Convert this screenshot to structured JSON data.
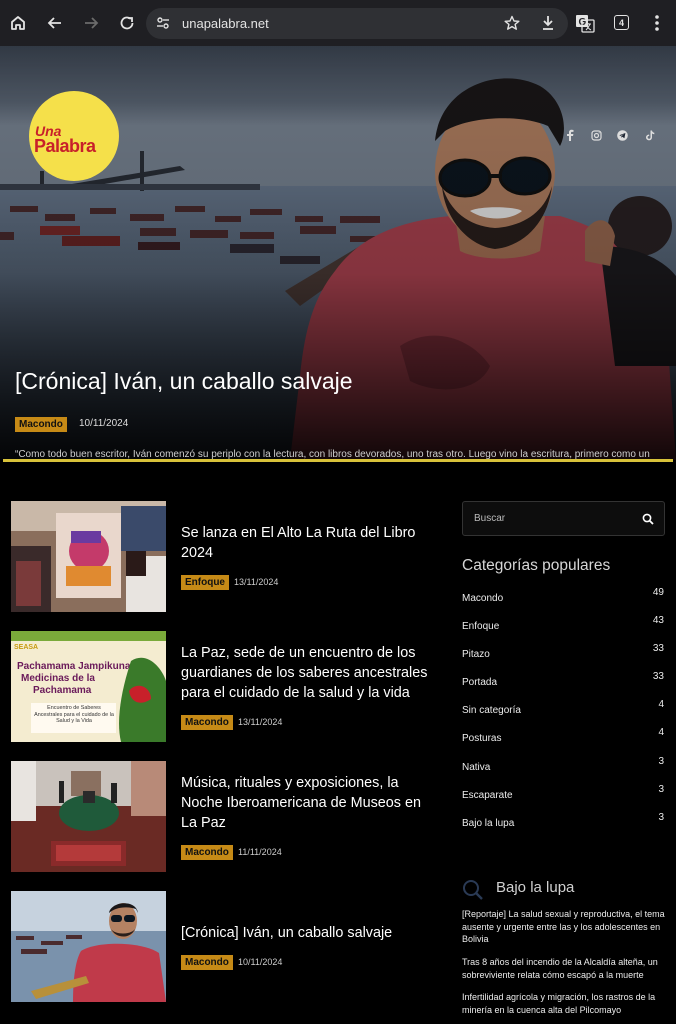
{
  "browser": {
    "url": "unapalabra.net",
    "tab_count": "4",
    "icons": [
      "home-icon",
      "back-icon",
      "forward-icon",
      "reload-icon",
      "site-info-icon",
      "star-icon",
      "download-icon",
      "translate-icon",
      "tabs-icon",
      "menu-icon"
    ]
  },
  "site": {
    "logo_una": "Una",
    "logo_palabra": "Palabra",
    "social_icons": [
      "facebook-icon",
      "instagram-icon",
      "telegram-icon",
      "tiktok-icon"
    ]
  },
  "hero": {
    "title": "[Crónica] Iván, un caballo salvaje",
    "category": "Macondo",
    "date": "10/11/2024",
    "excerpt": "“Como todo buen escritor, Iván comenzó su periplo con la lectura, con libros devorados, uno tras otro. Luego vino la escritura, primero como un juego, luego como una vocación”, escribe el cronista Rodrigo Villegas."
  },
  "articles": [
    {
      "title": "Se lanza en El Alto La Ruta del Libro 2024",
      "category": "Enfoque",
      "date": "13/11/2024"
    },
    {
      "title": "La Paz, sede de un encuentro de los guardianes de los saberes ancestrales para el cuidado de la salud y la vida",
      "category": "Macondo",
      "date": "13/11/2024"
    },
    {
      "title": "Música, rituales y exposiciones, la Noche Iberoamericana de Museos en La Paz",
      "category": "Macondo",
      "date": "11/11/2024"
    },
    {
      "title": "[Crónica] Iván, un caballo salvaje",
      "category": "Macondo",
      "date": "10/11/2024"
    }
  ],
  "thumb_texts": {
    "seasa": "SEASA",
    "pachamama_line1": "Pachamama Jampikuna",
    "pachamama_line2": "Medicinas de la",
    "pachamama_line3": "Pachamama",
    "encuentro": "Encuentro de Saberes Ancestrales para el cuidado de la Salud y la Vida"
  },
  "sidebar": {
    "search_placeholder": "Buscar",
    "categories_heading": "Categorías populares",
    "categories": [
      {
        "name": "Macondo",
        "count": "49"
      },
      {
        "name": "Enfoque",
        "count": "43"
      },
      {
        "name": "Pitazo",
        "count": "33"
      },
      {
        "name": "Portada",
        "count": "33"
      },
      {
        "name": "Sin categoría",
        "count": "4"
      },
      {
        "name": "Posturas",
        "count": "4"
      },
      {
        "name": "Nativa",
        "count": "3"
      },
      {
        "name": "Escaparate",
        "count": "3"
      },
      {
        "name": "Bajo la lupa",
        "count": "3"
      }
    ],
    "lupa_heading": "Bajo la lupa",
    "lupa_items": [
      "[Reportaje] La salud sexual y reproductiva, el tema ausente y urgente entre las y los adolescentes en Bolivia",
      "Tras 8 años del incendio de la Alcaldía alteña, un sobreviviente relata cómo escapó a la muerte",
      "Infertilidad agrícola y migración, los rastros de la minería en la cuenca alta del Pilcomayo"
    ]
  },
  "colors": {
    "accent_line": "#d8c23a",
    "badge": "#c68a16",
    "logo_bg": "#f5e04a",
    "logo_text": "#c8202a",
    "background": "#000000"
  }
}
